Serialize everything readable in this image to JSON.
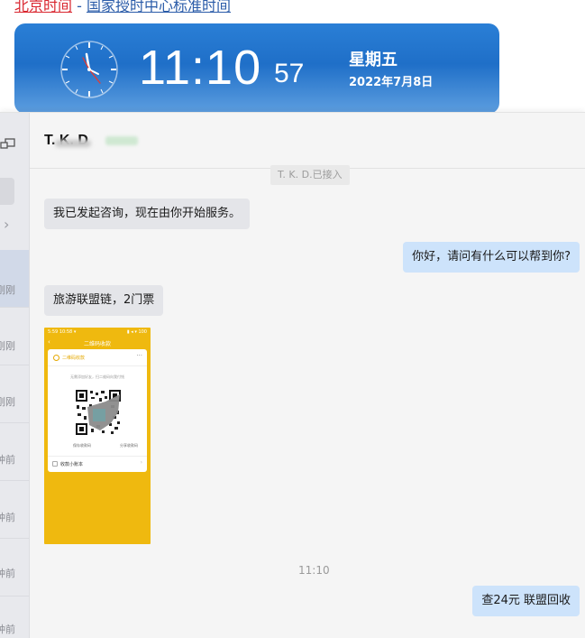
{
  "top_links": {
    "beijing_time": "北京时间",
    "separator": " - ",
    "ntsc_time": "国家授时中心标准时间"
  },
  "clock": {
    "time_hm": "11:10",
    "seconds": "57",
    "weekday": "星期五",
    "date": "2022年7月8日"
  },
  "chat": {
    "contact_name": "T. K. D",
    "system_note": "T. K. D.已接入",
    "sidebar_times": [
      "刚刚",
      "刚刚",
      "刚刚",
      "钟前",
      "钟前",
      "钟前",
      "钟前"
    ],
    "messages": [
      {
        "side": "left",
        "text": "我已发起咨询，现在由你开始服务。"
      },
      {
        "side": "right",
        "text": "你好，请问有什么可以帮到你?"
      },
      {
        "side": "left",
        "text": "旅游联盟链，2门票"
      },
      {
        "side": "right",
        "text": "查24元  联盟回收"
      }
    ],
    "time_separator": "11:10",
    "image_message": {
      "status_left": "5:59 10:58 ▾",
      "status_right": "▮ ◂ ▾ 100",
      "title": "二维码收款",
      "card_header": "二维码收款",
      "hint": "无需添加好友，扫二维码向我付钱",
      "save_label": "保存收款码",
      "share_label": "分享收款码",
      "account_label": "收款小账本"
    }
  },
  "colors": {
    "banner_top": "#2a7fd6",
    "bubble_right": "#cde3fb",
    "bubble_left": "#e4e5e9",
    "qr_bg": "#efb90f"
  }
}
